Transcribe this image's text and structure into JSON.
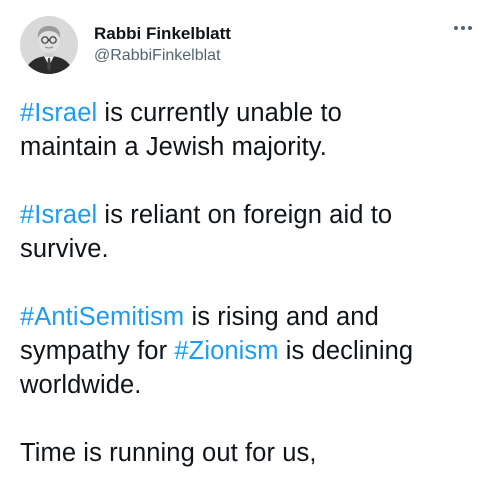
{
  "author": {
    "display_name": "Rabbi Finkelblatt",
    "handle": "@RabbiFinkelblat",
    "avatar_icon": "profile-photo"
  },
  "more_icon": "more-horizontal-icon",
  "accent_color": "#1d9bf0",
  "tweet": {
    "p1": {
      "tag": "#Israel",
      "text_a": " is currently unable to",
      "text_b": "maintain a Jewish majority."
    },
    "p2": {
      "tag": "#Israel",
      "text_a": " is reliant on foreign aid to",
      "text_b": "survive."
    },
    "p3": {
      "tag1": "#AntiSemitism",
      "text_a": " is rising and and",
      "text_b": "sympathy for ",
      "tag2": "#Zionism",
      "text_c": " is declining",
      "text_d": "worldwide."
    },
    "p4": {
      "text_a": "Time is running out for us,"
    }
  }
}
